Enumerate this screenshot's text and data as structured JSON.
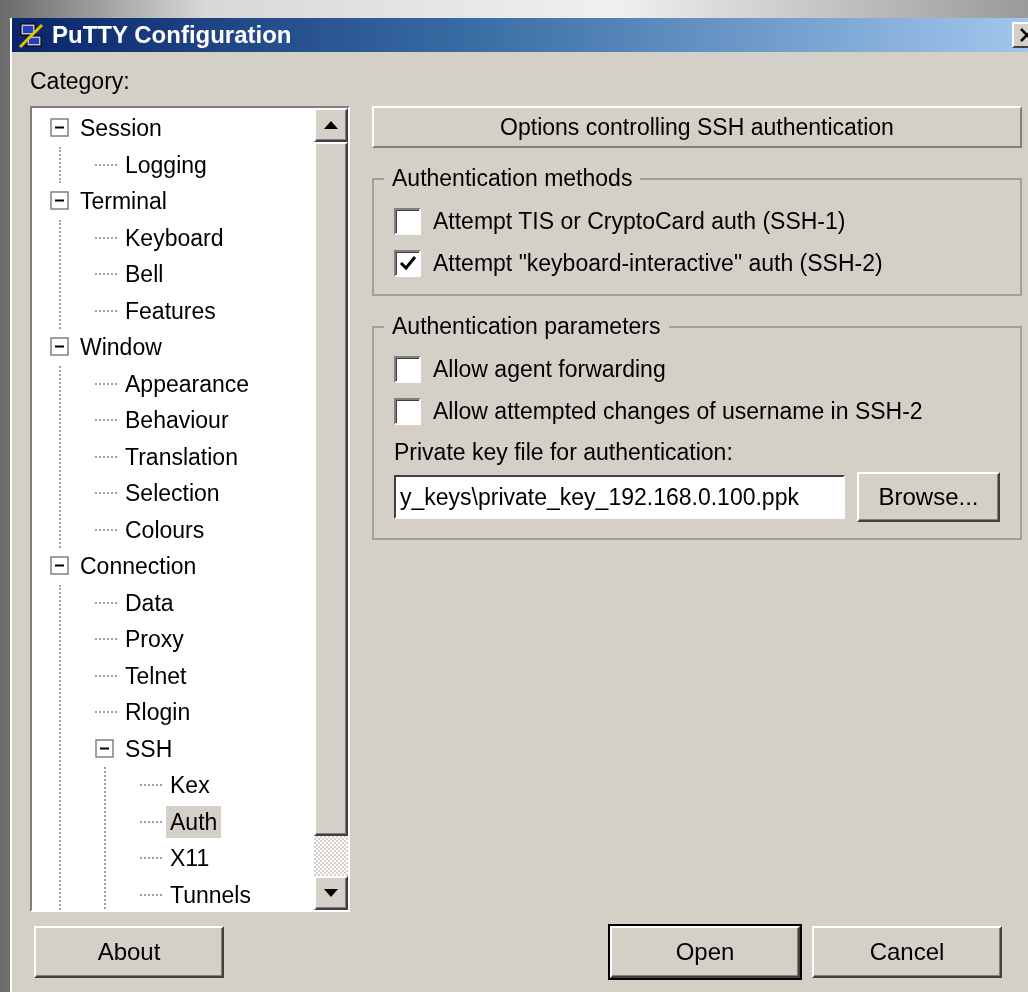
{
  "window": {
    "title": "PuTTY Configuration"
  },
  "category_label": "Category:",
  "tree": [
    {
      "label": "Session",
      "expanded": true,
      "selected": false,
      "children": [
        {
          "label": "Logging",
          "selected": false
        }
      ]
    },
    {
      "label": "Terminal",
      "expanded": true,
      "selected": false,
      "children": [
        {
          "label": "Keyboard",
          "selected": false
        },
        {
          "label": "Bell",
          "selected": false
        },
        {
          "label": "Features",
          "selected": false
        }
      ]
    },
    {
      "label": "Window",
      "expanded": true,
      "selected": false,
      "children": [
        {
          "label": "Appearance",
          "selected": false
        },
        {
          "label": "Behaviour",
          "selected": false
        },
        {
          "label": "Translation",
          "selected": false
        },
        {
          "label": "Selection",
          "selected": false
        },
        {
          "label": "Colours",
          "selected": false
        }
      ]
    },
    {
      "label": "Connection",
      "expanded": true,
      "selected": false,
      "children": [
        {
          "label": "Data",
          "selected": false
        },
        {
          "label": "Proxy",
          "selected": false
        },
        {
          "label": "Telnet",
          "selected": false
        },
        {
          "label": "Rlogin",
          "selected": false
        },
        {
          "label": "SSH",
          "expanded": true,
          "selected": false,
          "children": [
            {
              "label": "Kex",
              "selected": false
            },
            {
              "label": "Auth",
              "selected": true
            },
            {
              "label": "X11",
              "selected": false
            },
            {
              "label": "Tunnels",
              "selected": false
            }
          ]
        }
      ]
    }
  ],
  "panel_header": "Options controlling SSH authentication",
  "groups": [
    {
      "title": "Authentication methods",
      "checkboxes": [
        {
          "label": "Attempt TIS or CryptoCard auth (SSH-1)",
          "checked": false
        },
        {
          "label": "Attempt \"keyboard-interactive\" auth (SSH-2)",
          "checked": true
        }
      ]
    },
    {
      "title": "Authentication parameters",
      "checkboxes": [
        {
          "label": "Allow agent forwarding",
          "checked": false
        },
        {
          "label": "Allow attempted changes of username in SSH-2",
          "checked": false
        }
      ],
      "file_label": "Private key file for authentication:",
      "file_value": "y_keys\\private_key_192.168.0.100.ppk",
      "browse": "Browse..."
    }
  ],
  "buttons": {
    "about": "About",
    "open": "Open",
    "cancel": "Cancel"
  }
}
